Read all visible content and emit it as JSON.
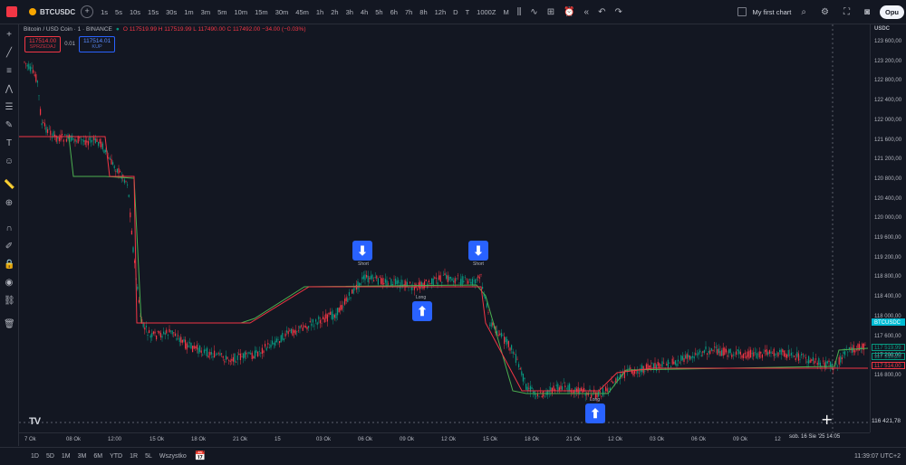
{
  "topbar": {
    "symbol": "BTCUSDC",
    "timeframes": [
      "1s",
      "5s",
      "10s",
      "15s",
      "30s",
      "1m",
      "3m",
      "5m",
      "10m",
      "15m",
      "30m",
      "45m",
      "1h",
      "2h",
      "3h",
      "4h",
      "5h",
      "6h",
      "7h",
      "8h",
      "12h",
      "D",
      "T",
      "1000Z",
      "M"
    ],
    "chart_name": "My first chart",
    "publish_label": "Opu"
  },
  "legend": {
    "title": "Bitcoin / USD Coin · 1 · BINANCE",
    "ohlc": "O 117519.99 H 117519.99 L 117490.00 C 117492.00 −34.00 (−0.03%)"
  },
  "order": {
    "sell_price": "117514.00",
    "sell_label": "SPRZEDAJ",
    "spread": "0.01",
    "buy_price": "117514.01",
    "buy_label": "KUP"
  },
  "price_axis": {
    "currency": "USDC",
    "ticks": [
      "123 600,00",
      "123 200,00",
      "122 800,00",
      "122 400,00",
      "122 000,00",
      "121 600,00",
      "121 200,00",
      "120 800,00",
      "120 400,00",
      "120 000,00",
      "119 600,00",
      "119 200,00",
      "118 800,00",
      "118 400,00",
      "118 000,00",
      "117 600,00",
      "117 200,00",
      "116 800,00"
    ],
    "labels": [
      {
        "text": "BTCUSDC",
        "color": "#00bcd4"
      },
      {
        "text": "117 519,99",
        "color": "#089981"
      },
      {
        "text": "117 510,20",
        "color": "#089981"
      },
      {
        "text": "117 514,00",
        "color": "#f23645"
      }
    ],
    "cursor_price": "116 421,78"
  },
  "time_axis": {
    "ticks": [
      "7 Ok",
      "08 Ok",
      "12:00",
      "15 Ok",
      "18 Ok",
      "21 Ok",
      "15",
      "03 Ok",
      "06 Ok",
      "09 Ok",
      "12 Ok",
      "15 Ok",
      "18 Ok",
      "21 Ok",
      "12 Ok",
      "03 Ok",
      "06 Ok",
      "09 Ok",
      "12"
    ],
    "cursor_time": "sob. 16 Sie '25 14:05"
  },
  "markers": [
    {
      "dir": "down",
      "label": "Short"
    },
    {
      "dir": "up",
      "label": "Long"
    },
    {
      "dir": "down",
      "label": "Short"
    },
    {
      "dir": "up",
      "label": "Long"
    }
  ],
  "bottombar": {
    "ranges": [
      "1D",
      "5D",
      "1M",
      "3M",
      "6M",
      "YTD",
      "1R",
      "5L",
      "Wszystko"
    ],
    "clock": "11:39:07 UTC+2"
  },
  "colors": {
    "up": "#089981",
    "down": "#f23645",
    "accent": "#2962ff"
  }
}
